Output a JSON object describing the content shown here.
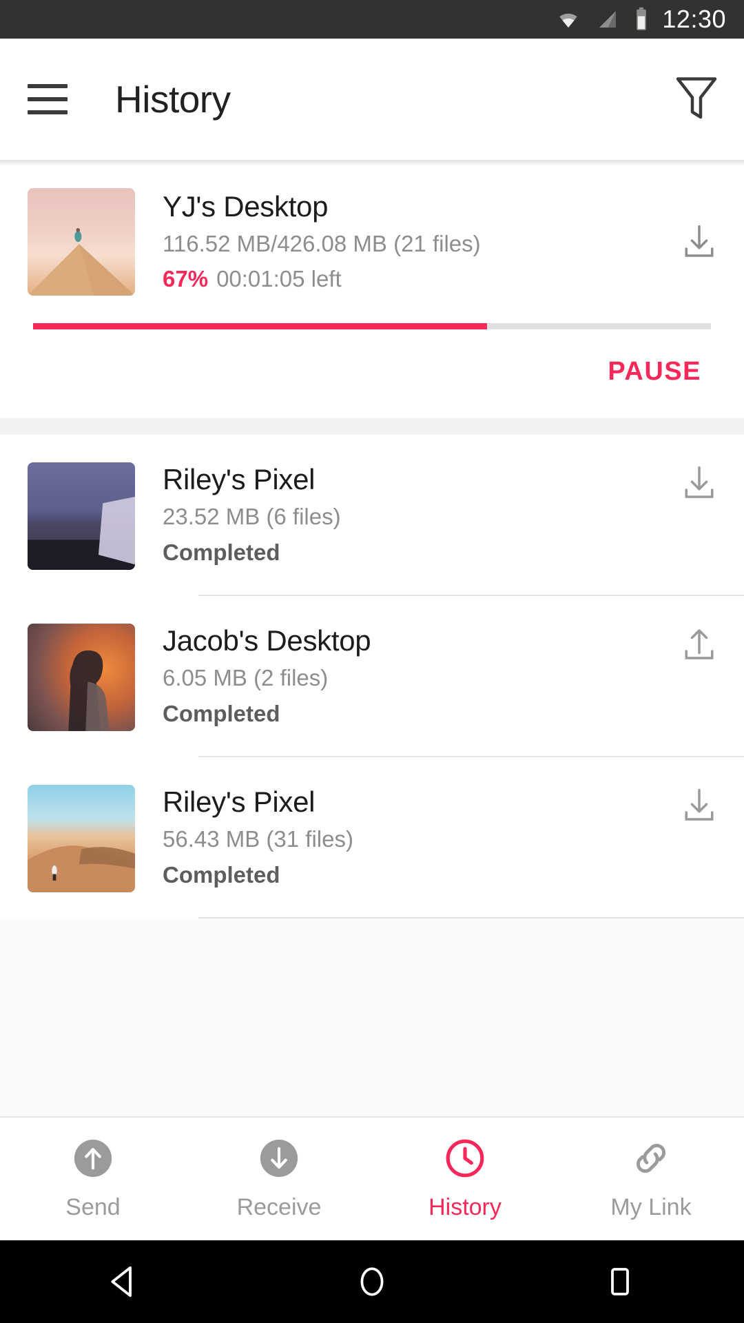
{
  "statusbar": {
    "time": "12:30",
    "icons": [
      "wifi-icon",
      "cellular-signal-icon",
      "battery-icon"
    ]
  },
  "appbar": {
    "menu_icon": "hamburger-menu-icon",
    "title": "History",
    "filter_icon": "filter-icon"
  },
  "active_transfer": {
    "title": "YJ's Desktop",
    "size": "116.52 MB/426.08 MB (21 files)",
    "percent": "67%",
    "percent_value": 67,
    "eta": "00:01:05 left",
    "action_icon": "download-icon",
    "pause_label": "PAUSE",
    "thumbnail": "desert-dune-pink-sky"
  },
  "transfers": [
    {
      "title": "Riley's Pixel",
      "size": "23.52 MB (6 files)",
      "status": "Completed",
      "action_icon": "download-icon",
      "thumbnail": "dusk-beach-blue"
    },
    {
      "title": "Jacob's Desktop",
      "size": "6.05 MB (2 files)",
      "status": "Completed",
      "action_icon": "upload-icon",
      "thumbnail": "silhouette-orange-glow"
    },
    {
      "title": "Riley's Pixel",
      "size": "56.43 MB (31 files)",
      "status": "Completed",
      "action_icon": "download-icon",
      "thumbnail": "desert-dune-blue-sky"
    }
  ],
  "bottom_nav": [
    {
      "label": "Send",
      "icon": "upload-circle-icon",
      "active": false
    },
    {
      "label": "Receive",
      "icon": "download-circle-icon",
      "active": false
    },
    {
      "label": "History",
      "icon": "clock-icon",
      "active": true
    },
    {
      "label": "My Link",
      "icon": "link-icon",
      "active": false
    }
  ],
  "system_nav": {
    "back_icon": "back-triangle-icon",
    "home_icon": "home-circle-icon",
    "recents_icon": "recents-square-icon"
  },
  "colors": {
    "accent": "#f8295a",
    "status_bar": "#323231",
    "muted_text": "#8d8d8d",
    "progress_track": "#e0e0e0"
  }
}
